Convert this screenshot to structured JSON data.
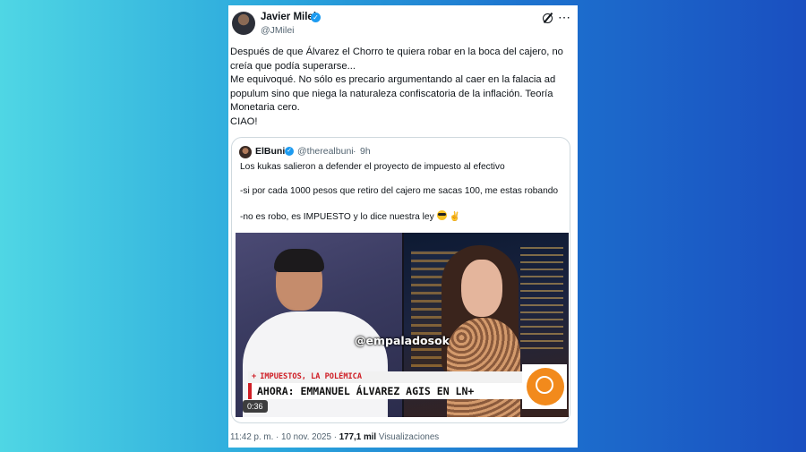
{
  "author": {
    "name": "Javier Milei",
    "handle": "@JMilei",
    "verified_mark": "✓"
  },
  "post": {
    "lines": [
      "Después de que Álvarez el Chorro te quiera robar en la boca del cajero, no",
      "creía que podía superarse...",
      "Me equivoqué. No sólo es precario argumentando al caer en la falacia ad",
      "populum sino que niega la naturaleza confiscatoria de la inflación. Teoría",
      "Monetaria cero.",
      "CIAO!"
    ]
  },
  "quote": {
    "name": "ElBuni",
    "handle": "@therealbuni",
    "separator": "·",
    "time": "9h",
    "verified_mark": "✓",
    "line1": "Los kukas salieron a defender el proyecto de impuesto al efectivo",
    "line2": "-si por cada 1000 pesos que retiro del cajero me sacas 100, me estas robando",
    "line3": "-no es robo, es IMPUESTO y lo dice nuestra ley",
    "hand_emoji": "✌"
  },
  "video": {
    "watermark": "@empaladosok",
    "lower_third_small": "IMPUESTOS, LA POLÉMICA",
    "lower_third_plus": "+",
    "lower_third_big": "AHORA: EMMANUEL ÁLVAREZ AGIS EN LN+",
    "duration": "0:36"
  },
  "footer": {
    "time": "11:42 p. m.",
    "separator": "·",
    "date": "10 nov. 2025",
    "views_count": "177,1 mil",
    "views_label": "Visualizaciones"
  },
  "icons": {
    "grok": "grok-icon",
    "more": "more-icon"
  },
  "colors": {
    "verified": "#1d9bf0",
    "secondary_text": "#536471",
    "lower_third_red": "#cf1d25",
    "logo_orange": "#f28a1c"
  }
}
